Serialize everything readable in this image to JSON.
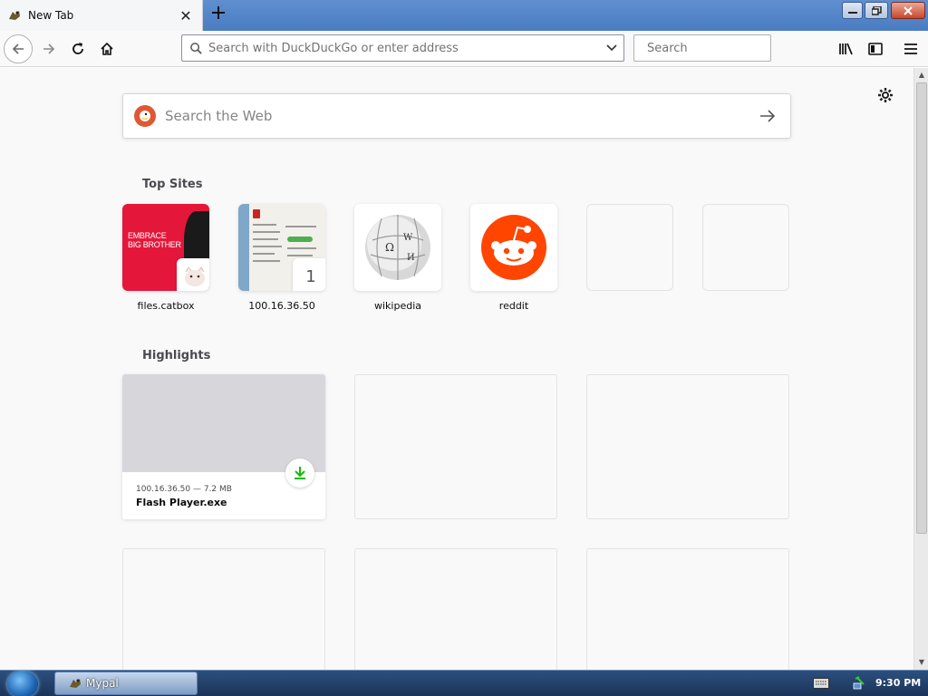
{
  "browser": {
    "tab_title": "New Tab",
    "url_placeholder": "Search with DuckDuckGo or enter address",
    "search_placeholder": "Search"
  },
  "newtab": {
    "web_search_placeholder": "Search the Web",
    "top_sites_title": "Top Sites",
    "top_sites": [
      {
        "label": "files.catbox",
        "thumb_text": [
          "EMBRACE",
          "BIG BROTHER"
        ]
      },
      {
        "label": "100.16.36.50",
        "badge": "1"
      },
      {
        "label": "wikipedia"
      },
      {
        "label": "reddit"
      },
      {
        "label": ""
      },
      {
        "label": ""
      }
    ],
    "highlights_title": "Highlights",
    "highlights": [
      {
        "meta": "100.16.36.50 — 7.2 MB",
        "name": "Flash Player.exe"
      }
    ]
  },
  "taskbar": {
    "app_label": "Mypal",
    "clock": "9:30 PM"
  },
  "colors": {
    "accent_ddg": "#de5833",
    "reddit": "#ff4500",
    "download_green": "#12bc00",
    "catbox_red": "#e4173a"
  }
}
